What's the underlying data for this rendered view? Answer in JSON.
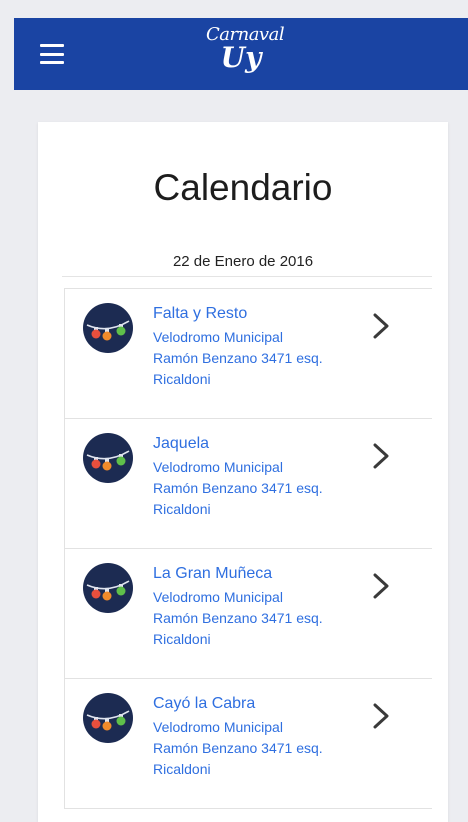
{
  "header": {
    "logo_line1": "Carnaval",
    "logo_line2": "Uy",
    "bg_color": "#1a44a3",
    "menu_icon": "hamburger-menu-icon"
  },
  "main": {
    "title": "Calendario",
    "date": "22 de Enero de 2016"
  },
  "events": [
    {
      "name": "Falta y Resto",
      "location": "Velodromo Municipal",
      "address": "Ramón Benzano 3471 esq. Ricaldoni",
      "icon": "festival-lights-icon"
    },
    {
      "name": "Jaquela",
      "location": "Velodromo Municipal",
      "address": "Ramón Benzano 3471 esq. Ricaldoni",
      "icon": "festival-lights-icon"
    },
    {
      "name": "La Gran Muñeca",
      "location": "Velodromo Municipal",
      "address": "Ramón Benzano 3471 esq. Ricaldoni",
      "icon": "festival-lights-icon"
    },
    {
      "name": "Cayó la Cabra",
      "location": "Velodromo Municipal",
      "address": "Ramón Benzano 3471 esq. Ricaldoni",
      "icon": "festival-lights-icon"
    }
  ]
}
